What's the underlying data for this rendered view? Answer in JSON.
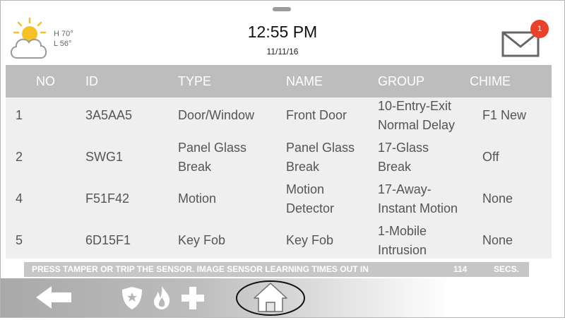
{
  "header": {
    "weather": {
      "icon": "partly-cloudy-icon",
      "high": "H 70°",
      "low": "L 56°"
    },
    "time": "12:55 PM",
    "date": "11/11/16",
    "messages": {
      "icon": "envelope-icon",
      "unread_count": "1"
    }
  },
  "table": {
    "columns": [
      "NO",
      "ID",
      "TYPE",
      "NAME",
      "GROUP",
      "CHIME"
    ],
    "rows": [
      {
        "no": "1",
        "id": "3A5AA5",
        "type": "Door/Window",
        "name": "Front Door",
        "group": "10-Entry-Exit\nNormal Delay",
        "chime": "F1 New"
      },
      {
        "no": "2",
        "id": "SWG1",
        "type": "Panel Glass\nBreak",
        "name": "Panel Glass\nBreak",
        "group": "17-Glass\nBreak",
        "chime": "Off"
      },
      {
        "no": "4",
        "id": "F51F42",
        "type": "Motion",
        "name": "Motion\nDetector",
        "group": "17-Away-\nInstant Motion",
        "chime": "None"
      },
      {
        "no": "5",
        "id": "6D15F1",
        "type": "Key Fob",
        "name": "Key Fob",
        "group": "1-Mobile\nIntrusion",
        "chime": "None"
      }
    ]
  },
  "status": {
    "message": "PRESS TAMPER OR TRIP THE SENSOR. IMAGE SENSOR LEARNING TIMES OUT IN",
    "seconds": "114",
    "unit": "SECS."
  },
  "footer": {
    "icons": [
      "back-arrow-icon",
      "police-shield-icon",
      "fire-icon",
      "medical-cross-icon",
      "home-icon"
    ]
  },
  "colors": {
    "header_row": "#bdbdbd",
    "table_bg": "#efefef",
    "badge": "#e8432a",
    "status_bar": "#c6c6c6",
    "sun": "#f5c226"
  }
}
